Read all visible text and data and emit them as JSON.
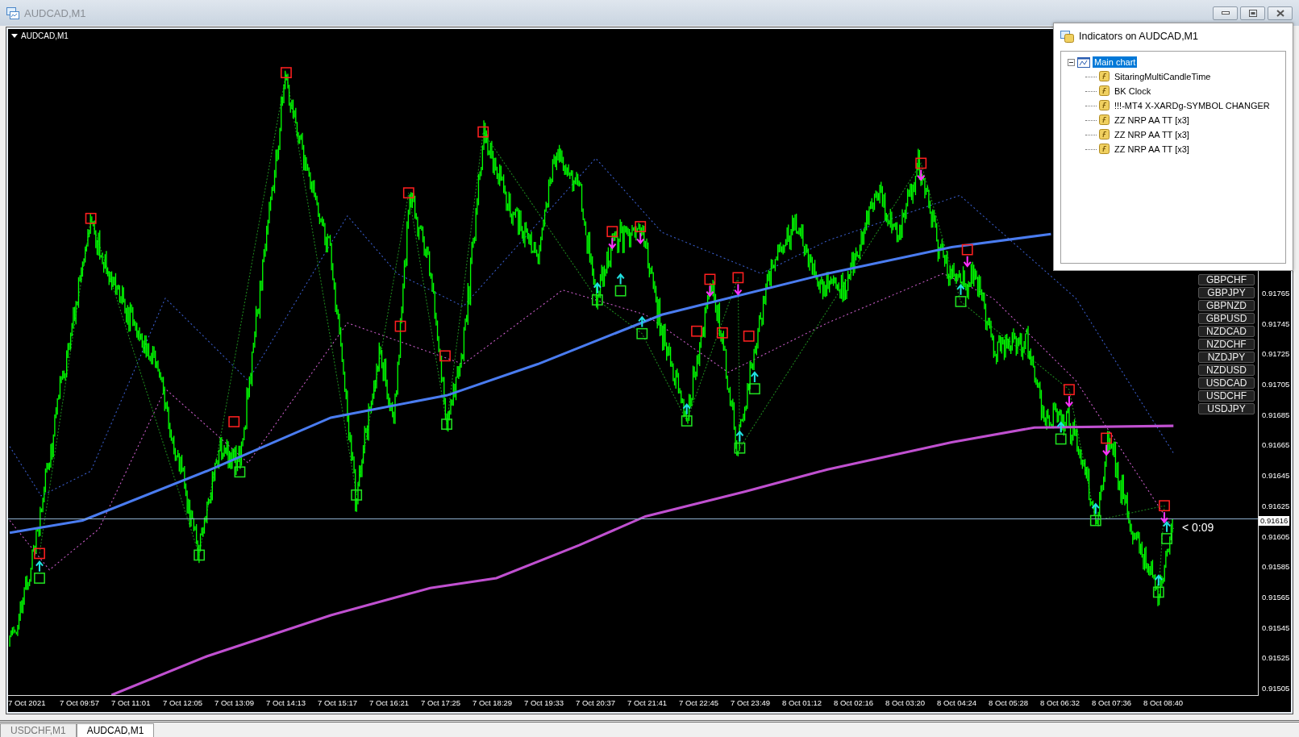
{
  "window": {
    "title": "AUDCAD,M1"
  },
  "chart": {
    "symbol_label": "AUDCAD,M1",
    "price_labels": [
      "0.91765",
      "0.91745",
      "0.91725",
      "0.91705",
      "0.91685",
      "0.91665",
      "0.91645",
      "0.91625",
      "0.91605",
      "0.91585",
      "0.91565",
      "0.91545",
      "0.91525",
      "0.91505"
    ],
    "current_price": "0.91616",
    "candle_timer": "< 0:09",
    "time_labels": [
      "7 Oct 2021",
      "7 Oct 09:57",
      "7 Oct 11:01",
      "7 Oct 12:05",
      "7 Oct 13:09",
      "7 Oct 14:13",
      "7 Oct 15:17",
      "7 Oct 16:21",
      "7 Oct 17:25",
      "7 Oct 18:29",
      "7 Oct 19:33",
      "7 Oct 20:37",
      "7 Oct 21:41",
      "7 Oct 22:45",
      "7 Oct 23:49",
      "8 Oct 01:12",
      "8 Oct 02:16",
      "8 Oct 03:20",
      "8 Oct 04:24",
      "8 Oct 05:28",
      "8 Oct 06:32",
      "8 Oct 07:36",
      "8 Oct 08:40"
    ]
  },
  "symbol_buttons": [
    "GBPCHF",
    "GBPJPY",
    "GBPNZD",
    "GBPUSD",
    "NZDCAD",
    "NZDCHF",
    "NZDJPY",
    "NZDUSD",
    "USDCAD",
    "USDCHF",
    "USDJPY"
  ],
  "indicators_dialog": {
    "title": "Indicators on AUDCAD,M1",
    "tree": [
      {
        "label": "Main chart",
        "selected": true,
        "expanded": true,
        "children": [
          {
            "label": "SitaringMultiCandleTime",
            "selected": false
          },
          {
            "label": "BK Clock",
            "selected": false
          },
          {
            "label": "!!!-MT4 X-XARDg-SYMBOL CHANGER",
            "selected": false
          },
          {
            "label": "ZZ NRP AA TT [x3]",
            "selected": false
          },
          {
            "label": "ZZ NRP AA TT [x3]",
            "selected": false
          },
          {
            "label": "ZZ NRP AA TT [x3]",
            "selected": false
          }
        ]
      }
    ]
  },
  "tabs": [
    {
      "label": "USDCHF,M1",
      "selected": false
    },
    {
      "label": "AUDCAD,M1",
      "selected": true
    }
  ]
}
